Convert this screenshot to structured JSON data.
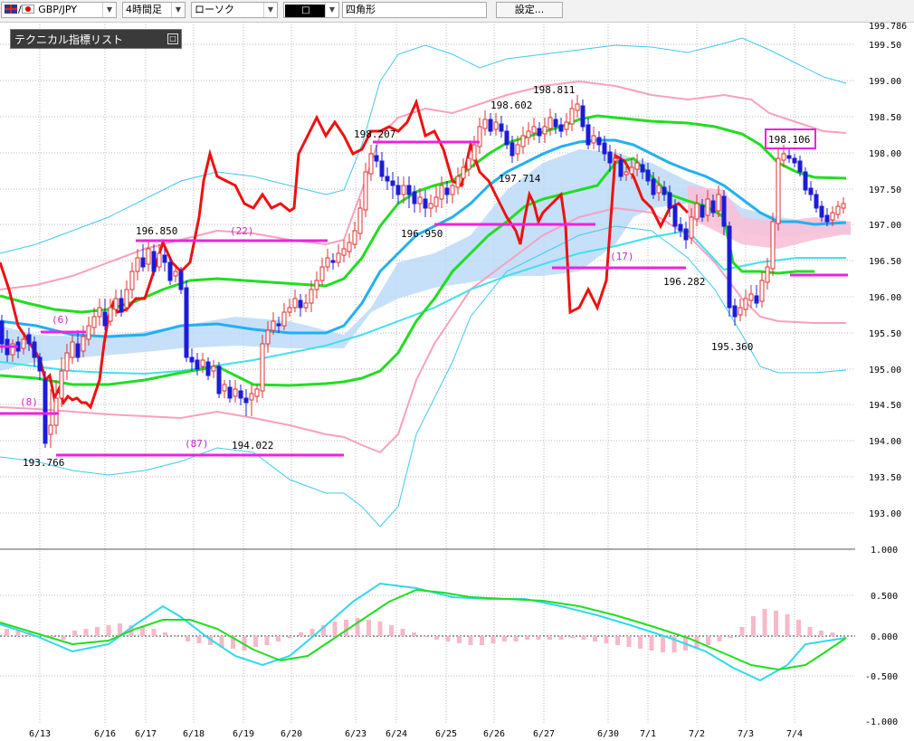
{
  "toolbar": {
    "pair": "GBP/JPY",
    "timeframe": "4時間足",
    "chart_type": "ローソク",
    "candle_style_icon": "□",
    "shape_tool": "四角形",
    "settings": "設定..."
  },
  "indicator_panel": {
    "title": "テクニカル指標リスト",
    "button": "□"
  },
  "price_axis": [
    "199.786",
    "199.50",
    "199.00",
    "198.50",
    "198.00",
    "197.50",
    "197.00",
    "196.50",
    "196.00",
    "195.50",
    "195.00",
    "194.50",
    "194.00",
    "193.50",
    "193.00"
  ],
  "macd_axis": [
    "1.000",
    "0.500",
    "0.000",
    "-0.500",
    "-1.000"
  ],
  "date_axis": [
    "6/13",
    "6/16",
    "6/17",
    "6/18",
    "6/19",
    "6/20",
    "6/23",
    "6/24",
    "6/25",
    "6/26",
    "6/27",
    "6/30",
    "7/1",
    "7/2",
    "7/3",
    "7/4"
  ],
  "annotations": {
    "a1": "193.766",
    "a2": "196.850",
    "a3": "(22)",
    "a4": "194.022",
    "a5": "(87)",
    "a6": "198.207",
    "a7": "196.950",
    "a8": "198.602",
    "a9": "198.811",
    "a10": "197.714",
    "a11": "(17)",
    "a12": "196.282",
    "a13": "195.360",
    "a14": "198.106",
    "a15": "(6)",
    "a16": "(8)"
  },
  "colors": {
    "bull": "#e03030",
    "bear": "#1c1cd8",
    "ma_short": "#00dd00",
    "ma_mid": "#00b0f0",
    "ma_long": "#40e0f0",
    "rci": "#ee1111",
    "bollinger_inner": "#f8a0c0",
    "bollinger_outer": "#40c8f0",
    "magenta": "#ee22dd",
    "macd": "#30d8f0",
    "signal": "#22dd22",
    "hist": "#f8b8c8"
  }
}
